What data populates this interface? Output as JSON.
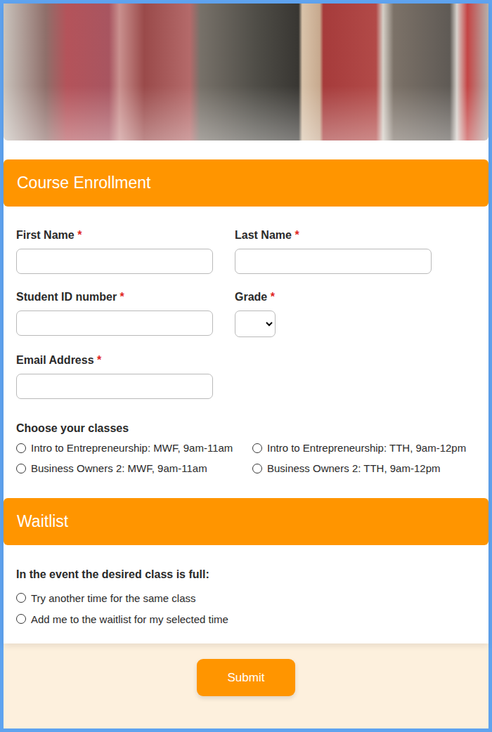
{
  "enrollment": {
    "title": "Course Enrollment",
    "fields": [
      {
        "label": "First Name",
        "required_mark": "*",
        "kind": "text",
        "value": ""
      },
      {
        "label": "Last Name",
        "required_mark": "*",
        "kind": "text",
        "value": ""
      },
      {
        "label": "Student ID number",
        "required_mark": "*",
        "kind": "text",
        "value": ""
      },
      {
        "label": "Grade",
        "required_mark": "*",
        "kind": "select",
        "value": ""
      },
      {
        "label": "Email Address",
        "required_mark": "*",
        "kind": "text",
        "value": ""
      }
    ],
    "classes": {
      "label": "Choose your classes",
      "options": [
        {
          "label": "Intro to Entrepreneurship: MWF, 9am-11am",
          "selected": false
        },
        {
          "label": "Intro to Entrepreneurship: TTH, 9am-12pm",
          "selected": false
        },
        {
          "label": "Business Owners 2: MWF, 9am-11am",
          "selected": false
        },
        {
          "label": "Business Owners 2: TTH, 9am-12pm",
          "selected": false
        }
      ]
    }
  },
  "waitlist": {
    "title": "Waitlist",
    "question": "In the event the desired class is full:",
    "options": [
      {
        "label": "Try another time for the same class",
        "selected": false
      },
      {
        "label": "Add me to the waitlist for my selected time",
        "selected": false
      }
    ]
  },
  "submit": {
    "label": "Submit"
  }
}
